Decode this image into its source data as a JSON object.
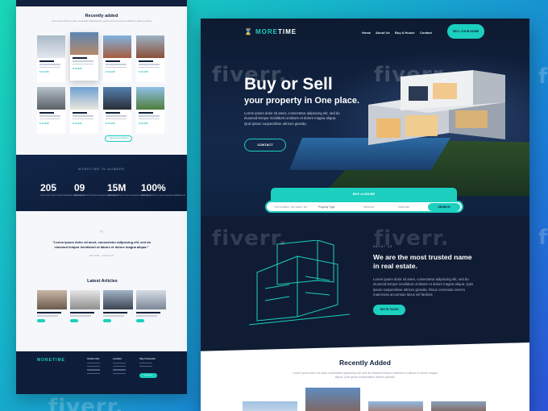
{
  "watermark": "fiverr.",
  "left_page": {
    "recently_added": {
      "title": "Recently added",
      "subtitle": "Lorem ipsum dolor sit amet, consectetur adipiscing elit, sed do eiusmod tempor incididunt ut labore et dolore",
      "prices": [
        "$ 13,125",
        "$ 15,525",
        "$ 13,125",
        "$ 13,125",
        "$ 13,125",
        "$ 13,125",
        "$ 13,125",
        "$ 13,125"
      ],
      "button": "Show more Listings"
    },
    "stats": {
      "caption": "MORETIME IN NUMBER",
      "items": [
        {
          "value": "205",
          "label": "Lorem ipsum dolor sit amet consectetur adipiscing elit"
        },
        {
          "value": "09",
          "label": "Lorem ipsum dolor sit amet consectetur adipiscing elit"
        },
        {
          "value": "15M",
          "label": "Lorem ipsum dolor sit amet consectetur adipiscing elit"
        },
        {
          "value": "100%",
          "label": "Lorem ipsum dolor sit amet consectetur adipiscing elit"
        }
      ]
    },
    "testimonial": {
      "text": "\"Lorem ipsum dolor sit amet, consectetur adipiscing elit, sed do eiusmod tempor incididunt ut labore et dolore magna aliqua.\"",
      "author": "John Smith — Lorem Ipsum"
    },
    "articles": {
      "title": "Latest Articles"
    },
    "footer": {
      "brand": "MORETIME",
      "col1": "Useful Links",
      "col2": "Location",
      "col3": "Stay Connected",
      "subscribe": "Subscribe"
    }
  },
  "header": {
    "logo": {
      "icon": "hourglass-icon",
      "prefix": "MORE",
      "suffix": "TIME"
    },
    "nav": [
      "Home",
      "About Us",
      "Buy A House",
      "Contact"
    ],
    "cta": "SELL YOUR HOME"
  },
  "hero": {
    "title": "Buy or Sell",
    "subtitle": "your property in One place.",
    "text": "Lorem ipsum dolor sit amet, consectetur adipiscing elit, sed do eiusmod tempor incididunt ut labore et dolore magna aliqua. Quis ipsum suspendisse ultrices gravida.",
    "button": "CONTACT"
  },
  "search": {
    "tab": "BUY A HOUSE",
    "location_placeholder": "Your location, city name, etc.",
    "type": "Property Type",
    "min": "Minimum",
    "max": "Maximum",
    "button": "SEARCH"
  },
  "about": {
    "caption": "ABOUT US",
    "heading": "We are the most trusted name in real estate.",
    "text": "Lorem ipsum dolor sit amet, consectetur adipiscing elit, sed do eiusmod tempor incididunt ut labore et dolore magna aliqua. Quis ipsum suspendisse ultrices gravida. Risus commodo viverra maecenas accumsan lacus vel facilisis.",
    "button": "GET IN TOUCH"
  },
  "recent": {
    "title": "Recently Added",
    "subtitle": "Lorem ipsum dolor sit amet, consectetur adipiscing elit, sed do eiusmod tempor incididunt ut labore et dolore magna aliqua. Quis ipsum suspendisse ultrices gravida."
  },
  "colors": {
    "accent": "#1ccfbf",
    "navy": "#0f1c33",
    "background_gradient_start": "#19d8b8",
    "background_gradient_end": "#2d55d8"
  }
}
